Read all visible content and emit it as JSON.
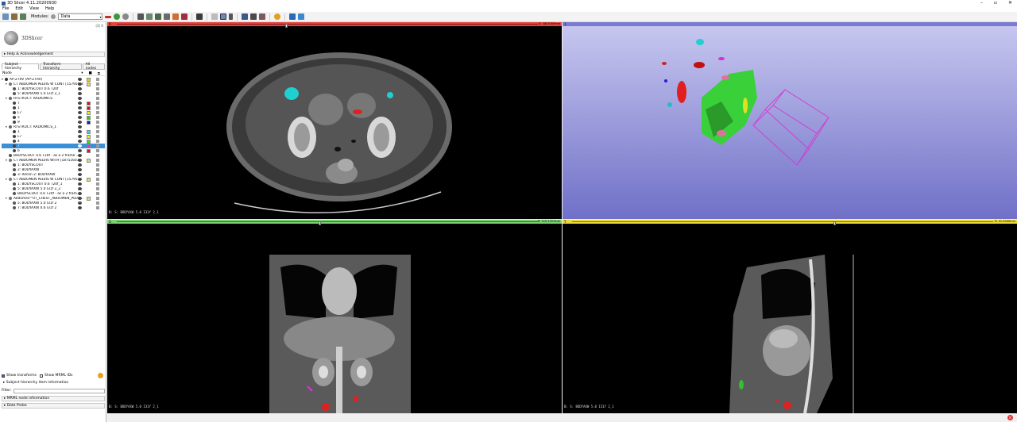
{
  "window": {
    "title": "3D Slicer 4.11.20200930"
  },
  "menu": [
    "File",
    "Edit",
    "View",
    "Help"
  ],
  "toolbar": {
    "modules_label": "Modules:",
    "module_value": "Data"
  },
  "panel": {
    "version": "(3) X",
    "logo_text": "3DSlicer",
    "help_section": "Help & Acknowledgement",
    "tabs": [
      {
        "label": "Subject hierarchy"
      },
      {
        "label": "Transform hierarchy"
      },
      {
        "label": "All nodes"
      }
    ],
    "tree_header": "Node",
    "tree": [
      {
        "label": "AP-ZTRV (AP-ZTRV)",
        "indent": 0,
        "tw": "▾",
        "swatch": "#f0d000",
        "color": "#333"
      },
      {
        "label": "CT ABDOMEN PELVIS W CONT [15795016...",
        "indent": 1,
        "tw": "▾",
        "swatch": "#e0e060",
        "color": "#777"
      },
      {
        "label": "1: BODYSCOUT 0.6 T20f",
        "indent": 2,
        "tw": "",
        "swatch": "",
        "color": "#555"
      },
      {
        "label": "5: BODYAXW 5.0 I31f 2_1",
        "indent": 2,
        "tw": "",
        "swatch": "",
        "color": "#555"
      },
      {
        "label": "RTSTRUCT: RADIOMICS",
        "indent": 1,
        "tw": "▾",
        "swatch": "",
        "color": "#666"
      },
      {
        "label": "7",
        "indent": 2,
        "tw": "",
        "swatch": "#e01010",
        "color": "#444"
      },
      {
        "label": "1",
        "indent": 2,
        "tw": "",
        "swatch": "#e01010",
        "color": "#444"
      },
      {
        "label": "L7",
        "indent": 2,
        "tw": "",
        "swatch": "#f0f000",
        "color": "#444"
      },
      {
        "label": "5",
        "indent": 2,
        "tw": "",
        "swatch": "#20d020",
        "color": "#444"
      },
      {
        "label": "9",
        "indent": 2,
        "tw": "",
        "swatch": "#1010d0",
        "color": "#444"
      },
      {
        "label": "RTSTRUCT: RADIOMICS_1",
        "indent": 1,
        "tw": "▾",
        "swatch": "",
        "color": "#666"
      },
      {
        "label": "1",
        "indent": 2,
        "tw": "",
        "swatch": "#20e0e0",
        "color": "#444"
      },
      {
        "label": "L7",
        "indent": 2,
        "tw": "",
        "swatch": "#f0f000",
        "color": "#444"
      },
      {
        "label": "4",
        "indent": 2,
        "tw": "",
        "swatch": "#30e030",
        "color": "#444"
      },
      {
        "label": "7",
        "indent": 2,
        "tw": "",
        "swatch": "#e030e0",
        "color": "#444",
        "selected": true
      },
      {
        "label": "6",
        "indent": 2,
        "tw": "",
        "swatch": "#e01010",
        "color": "#444"
      },
      {
        "label": "BODYSCOUT 0.6 T20f - as a 2 frame ...",
        "indent": 1,
        "tw": "",
        "swatch": "",
        "color": "#555"
      },
      {
        "label": "CT ABDOMEN PELVIS WITH [18751603]",
        "indent": 1,
        "tw": "▾",
        "swatch": "#e0e060",
        "color": "#777"
      },
      {
        "label": "1: BODYSCOUT",
        "indent": 2,
        "tw": "",
        "swatch": "",
        "color": "#555"
      },
      {
        "label": "2: BODYAXW",
        "indent": 2,
        "tw": "",
        "swatch": "",
        "color": "#555"
      },
      {
        "label": "3: Recon 2: BODYAXW",
        "indent": 2,
        "tw": "",
        "swatch": "",
        "color": "#555"
      },
      {
        "label": "CT ABDOMEN PELVIS W CONT [15795...",
        "indent": 1,
        "tw": "▾",
        "swatch": "#e0e060",
        "color": "#777"
      },
      {
        "label": "1: BODYSCOUT 0.6 T20f_1",
        "indent": 2,
        "tw": "",
        "swatch": "",
        "color": "#555"
      },
      {
        "label": "5: BODYAXW 5.0 I31f 2_2",
        "indent": 2,
        "tw": "",
        "swatch": "",
        "color": "#555"
      },
      {
        "label": "BODYSCOUT 0.6 T20f - as a 2 fram...",
        "indent": 2,
        "tw": "",
        "swatch": "",
        "color": "#555"
      },
      {
        "label": "Abdomen^07_CHEST_ABDOMEN_PELVI...",
        "indent": 1,
        "tw": "▾",
        "swatch": "#e0e060",
        "color": "#777"
      },
      {
        "label": "5: BODYAXW 5.0 I31f 2",
        "indent": 2,
        "tw": "",
        "swatch": "",
        "color": "#555"
      },
      {
        "label": "7: BODYAXW 0.6 I31f 2",
        "indent": 2,
        "tw": "",
        "swatch": "",
        "color": "#555"
      }
    ],
    "show_transforms": "Show transforms",
    "show_mrml_ids": "Show MRML IDs",
    "item_info": "Subject hierarchy item information",
    "filter_label": "Filter:",
    "mrml_info": "MRML node information",
    "data_probe": "Data Probe"
  },
  "views": {
    "red": {
      "name": "R",
      "offset": "S: -88.5000mm",
      "corner": "B: S: BODYAXW 5.0 I31f 2_1",
      "color": "#e8403a"
    },
    "threed": {
      "name": "1",
      "color": "#7a7ad0"
    },
    "green": {
      "name": "G",
      "offset": "R: 115.1357mm",
      "corner": "B: S: BODYAXW 5.0 I31f 2_1",
      "color": "#7ad070"
    },
    "yellow": {
      "name": "Y",
      "offset": "R: 41.0000mm",
      "corner": "B: S: BODYAXW 5.0 I31f 2_1",
      "color": "#e8d83a"
    }
  },
  "status": {
    "icon": "error-icon",
    "glyph": "×"
  }
}
